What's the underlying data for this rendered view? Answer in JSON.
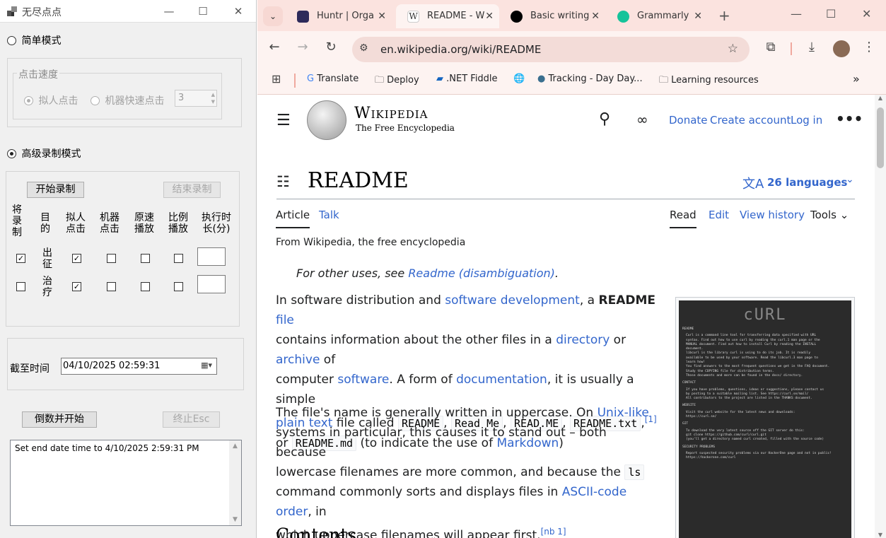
{
  "app": {
    "title": "无尽点点",
    "minimize": "—",
    "maximize": "☐",
    "close": "✕",
    "simple_mode_label": "简单模式",
    "click_speed_group": "点击速度",
    "human_click_label": "拟人点击",
    "machine_click_label": "机器快速点击",
    "speed_value": "3",
    "advanced_mode_label": "高级录制模式",
    "start_record_button": "开始录制",
    "end_record_button": "结束录制",
    "col_headers": [
      "将录制",
      "目的",
      "拟人点击",
      "机器点击",
      "原速播放",
      "比例播放",
      "执行时长(分)"
    ],
    "rows": [
      {
        "purpose": "出征",
        "record": true,
        "human": true,
        "machine": false,
        "original": false,
        "ratio": false,
        "duration": ""
      },
      {
        "purpose": "治疗",
        "record": false,
        "human": true,
        "machine": false,
        "original": false,
        "ratio": false,
        "duration": ""
      }
    ],
    "deadline_label": "截至时间",
    "deadline_value": "04/10/2025 02:59:31",
    "countdown_button": "倒数并开始",
    "stop_button": "终止Esc",
    "log_text": "Set end date time to 4/10/2025 2:59:31 PM"
  },
  "browser": {
    "tabs": [
      {
        "title": "Huntr | Orga",
        "icon": "huntr-icon",
        "color": "#2d2a5a"
      },
      {
        "title": "README - W",
        "icon": "wikipedia-icon",
        "color": "#ffffff",
        "active": true
      },
      {
        "title": "Basic writing",
        "icon": "github-icon",
        "color": "#000000"
      },
      {
        "title": "Grammarly",
        "icon": "grammarly-icon",
        "color": "#15c39a"
      }
    ],
    "new_tab": "+",
    "url": "en.wikipedia.org/wiki/README",
    "bookmarks": [
      "Translate",
      "Deploy",
      ".NET Fiddle",
      "Tracking - Day Day...",
      "Learning resources"
    ],
    "more_bookmarks": "»"
  },
  "wiki": {
    "logo_title": "Wikipedia",
    "logo_tagline": "The Free Encyclopedia",
    "donate": "Donate",
    "create_account": "Create account",
    "log_in": "Log in",
    "article_title": "README",
    "languages": "26 languages",
    "tab_article": "Article",
    "tab_talk": "Talk",
    "tab_read": "Read",
    "tab_edit": "Edit",
    "tab_history": "View history",
    "tab_tools": "Tools",
    "from_wiki": "From Wikipedia, the free encyclopedia",
    "hatnote_prefix": "For other uses, see ",
    "hatnote_link": "Readme (disambiguation)",
    "hatnote_suffix": ".",
    "p1": {
      "t1": "In software distribution and ",
      "l1": "software development",
      "t2": ", a ",
      "b1": "README",
      "t3": " ",
      "l2": "file",
      "t4": "contains information about the other files in a ",
      "l3": "directory",
      "t5": " or ",
      "l4": "archive",
      "t6": " of",
      "t7": "computer ",
      "l5": "software",
      "t8": ". A form of ",
      "l6": "documentation",
      "t9": ", it is usually a simple",
      "l7": "plain text",
      "t10": " file called ",
      "c1": "README",
      "c2": "Read Me",
      "c3": "READ.ME",
      "c4": "README.txt",
      "ref1": "[1]",
      "t11": "or ",
      "c5": "README.md",
      "t12": " (to indicate the use of ",
      "l8": "Markdown",
      "t13": ")"
    },
    "p2": {
      "t1": "The file's name is generally written in uppercase. On ",
      "l1": "Unix-like",
      "t2": "systems in particular, this causes it to stand out – both because",
      "t3": "lowercase filenames are more common, and because the ",
      "c1": "ls",
      "t4": "command commonly sorts and displays files in ",
      "l2": "ASCII-code order",
      "t5": ", in",
      "t6": "which uppercase filenames will appear first.",
      "ref": "[nb 1]"
    },
    "contents_heading": "Contents",
    "image_caption_lines": [
      "README",
      "Curl is a command line tool for transferring data specified with URL",
      "syntax. Find out how to use curl by reading the curl.1 man page or the",
      "MANUAL document. Find out how to install Curl by reading the INSTALL",
      "document.",
      "libcurl is the library curl is using to do its job. It is readily",
      "available to be used by your software. Read the libcurl.3 man page to",
      "learn how!",
      "You find answers to the most frequent questions we get in the FAQ document.",
      "Study the COPYING file for distribution terms.",
      "Those documents and more can be found in the docs/ directory.",
      "CONTACT",
      "If you have problems, questions, ideas or suggestions, please contact us",
      "by posting to a suitable mailing list. See https://curl.se/mail/",
      "All contributors to the project are listed in the THANKS document.",
      "WEBSITE",
      "Visit the curl website for the latest news and downloads:",
      "https://curl.se/",
      "GIT",
      "To download the very latest source off the GIT server do this:",
      "git clone https://github.com/curl/curl.git",
      "(you'll get a directory named curl created, filled with the source code)",
      "SECURITY PROBLEMS",
      "Report suspected security problems via our HackerOne page and not in public!",
      "https://hackerone.com/curl"
    ]
  }
}
